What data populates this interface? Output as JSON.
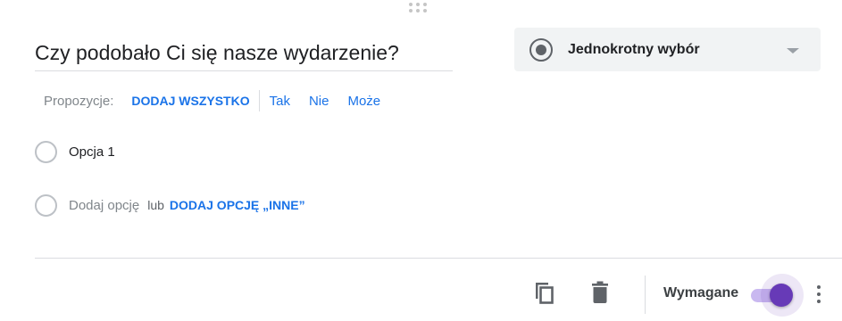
{
  "question": {
    "title": "Czy podobało Ci się nasze wydarzenie?"
  },
  "question_type": {
    "selected": "Jednokrotny wybór",
    "icon": "radio-button-checked-icon"
  },
  "suggestions": {
    "label": "Propozycje:",
    "add_all": "DODAJ WSZYSTKO",
    "items": [
      "Tak",
      "Nie",
      "Może"
    ]
  },
  "options": [
    {
      "label": "Opcja 1"
    }
  ],
  "add_option": {
    "placeholder": "Dodaj opcję",
    "or_text": "lub",
    "add_other": "DODAJ OPCJĘ „INNE”"
  },
  "footer": {
    "copy_icon": "content-copy-icon",
    "delete_icon": "trash-icon",
    "required_label": "Wymagane",
    "required_on": true,
    "more_icon": "more-vert-icon"
  },
  "colors": {
    "accent": "#673ab7",
    "link": "#1a73e8",
    "select_bg": "#f1f3f4"
  }
}
